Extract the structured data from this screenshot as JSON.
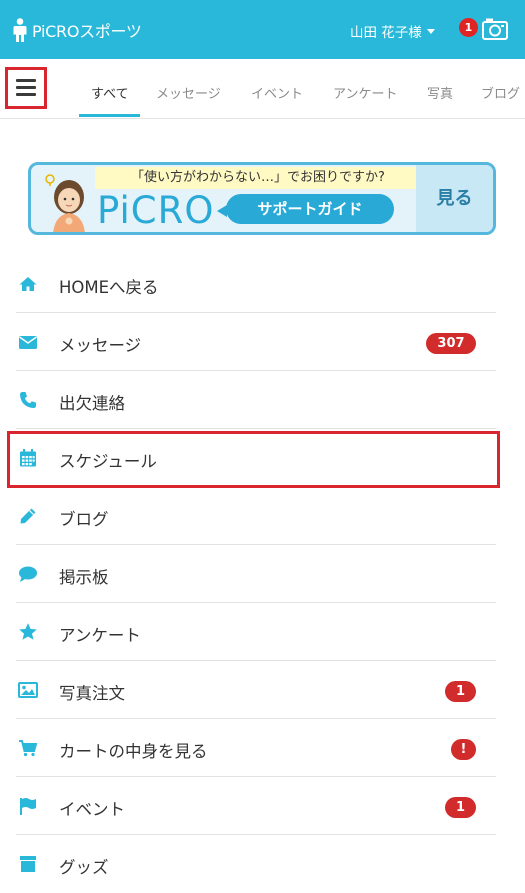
{
  "header": {
    "app_name": "PiCROスポーツ",
    "user_name": "山田 花子様",
    "notification_count": "1",
    "brand_color": "#29b8d9"
  },
  "tabs": [
    {
      "label": "すべて",
      "active": true
    },
    {
      "label": "メッセージ"
    },
    {
      "label": "イベント"
    },
    {
      "label": "アンケート"
    },
    {
      "label": "写真"
    },
    {
      "label": "ブログ"
    }
  ],
  "banner": {
    "question": "「使い方がわからない…」でお困りですか?",
    "brand": "PiCRO",
    "guide": "サポートガイド",
    "see": "見る"
  },
  "menu": [
    {
      "label": "HOMEへ戻る",
      "icon": "home-icon"
    },
    {
      "label": "メッセージ",
      "icon": "envelope-icon",
      "badge": "307"
    },
    {
      "label": "出欠連絡",
      "icon": "phone-icon"
    },
    {
      "label": "スケジュール",
      "icon": "calendar-icon"
    },
    {
      "label": "ブログ",
      "icon": "pencil-icon"
    },
    {
      "label": "掲示板",
      "icon": "speech-bubble-icon"
    },
    {
      "label": "アンケート",
      "icon": "star-icon"
    },
    {
      "label": "写真注文",
      "icon": "image-icon",
      "badge": "1"
    },
    {
      "label": "カートの中身を見る",
      "icon": "cart-icon",
      "badge": "!"
    },
    {
      "label": "イベント",
      "icon": "flag-icon",
      "badge": "1"
    },
    {
      "label": "グッズ",
      "icon": "store-icon"
    }
  ],
  "colors": {
    "accent": "#29b8d9",
    "badge": "#d22b2b",
    "highlight": "#d9262e"
  }
}
